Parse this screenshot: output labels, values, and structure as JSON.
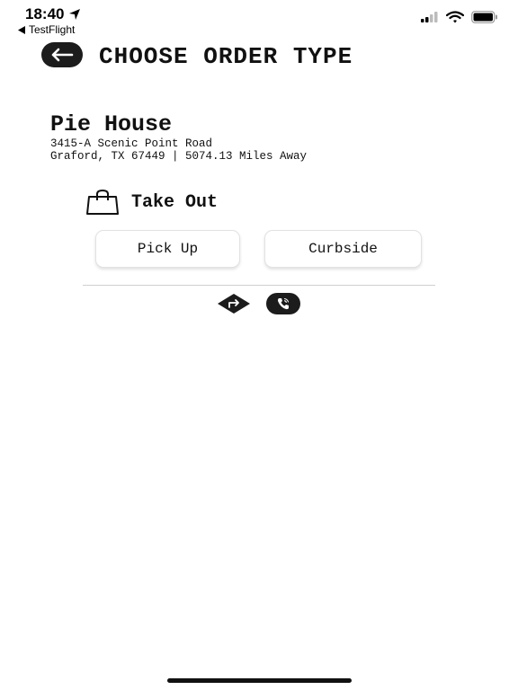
{
  "status_bar": {
    "time": "18:40",
    "back_app": "TestFlight"
  },
  "header": {
    "title": "CHOOSE ORDER TYPE"
  },
  "restaurant": {
    "name": "Pie House",
    "address_line1": "3415-A Scenic Point Road",
    "address_line2": "Graford, TX 67449 | 5074.13 Miles Away"
  },
  "section": {
    "title": "Take Out",
    "options": [
      {
        "label": "Pick Up"
      },
      {
        "label": "Curbside"
      }
    ]
  },
  "icons": {
    "back": "arrow-left-icon",
    "bag": "shopping-bag-icon",
    "directions": "directions-icon",
    "call": "phone-icon"
  }
}
